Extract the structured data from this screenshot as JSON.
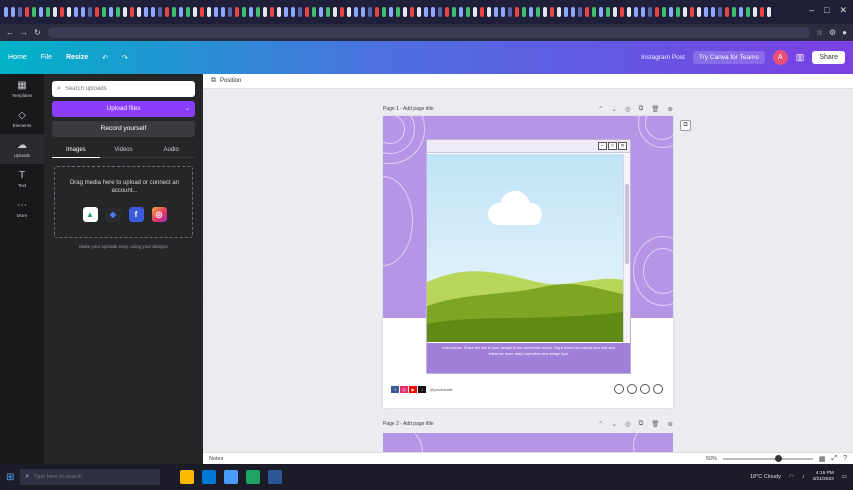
{
  "header": {
    "home_label": "Home",
    "file_label": "File",
    "resize_label": "Resize",
    "design_title": "Instagram Post",
    "try_label": "Try Canva for Teams",
    "avatar_initial": "A",
    "share_label": "Share"
  },
  "rail": {
    "items": [
      {
        "label": "Templates",
        "icon": "template-icon"
      },
      {
        "label": "Elements",
        "icon": "elements-icon"
      },
      {
        "label": "Uploads",
        "icon": "uploads-icon"
      },
      {
        "label": "Text",
        "icon": "text-icon"
      },
      {
        "label": "More",
        "icon": "more-icon"
      }
    ]
  },
  "panel": {
    "search_placeholder": "Search uploads",
    "upload_label": "Upload files",
    "record_label": "Record yourself",
    "tabs": [
      "Images",
      "Videos",
      "Audio"
    ],
    "drop_text": "Drag media here to upload or connect an account...",
    "hint": "Make your uploads easy, using your designs"
  },
  "canvas": {
    "toolbar_label": "Position",
    "page1_label": "Page 1 - Add page title",
    "page2_label": "Page 2 - Add page title",
    "caption": "Instructions: Share the link to your design in the comments below. Tag a friend who would love this and follow for more daily inspiration and design tips!",
    "handle": "@yourhandle",
    "zoom_value": 0.62,
    "zoom_label": "50%",
    "notes_label": "Notes",
    "colors": {
      "purple": "#b596e6",
      "caption_bg": "#a07fd8",
      "accent": "#8b3dff"
    }
  },
  "taskbar": {
    "search_placeholder": "Type here to search",
    "time": "4:15 PM",
    "date": "3/21/2023",
    "weather": "18°C Cloudy"
  }
}
